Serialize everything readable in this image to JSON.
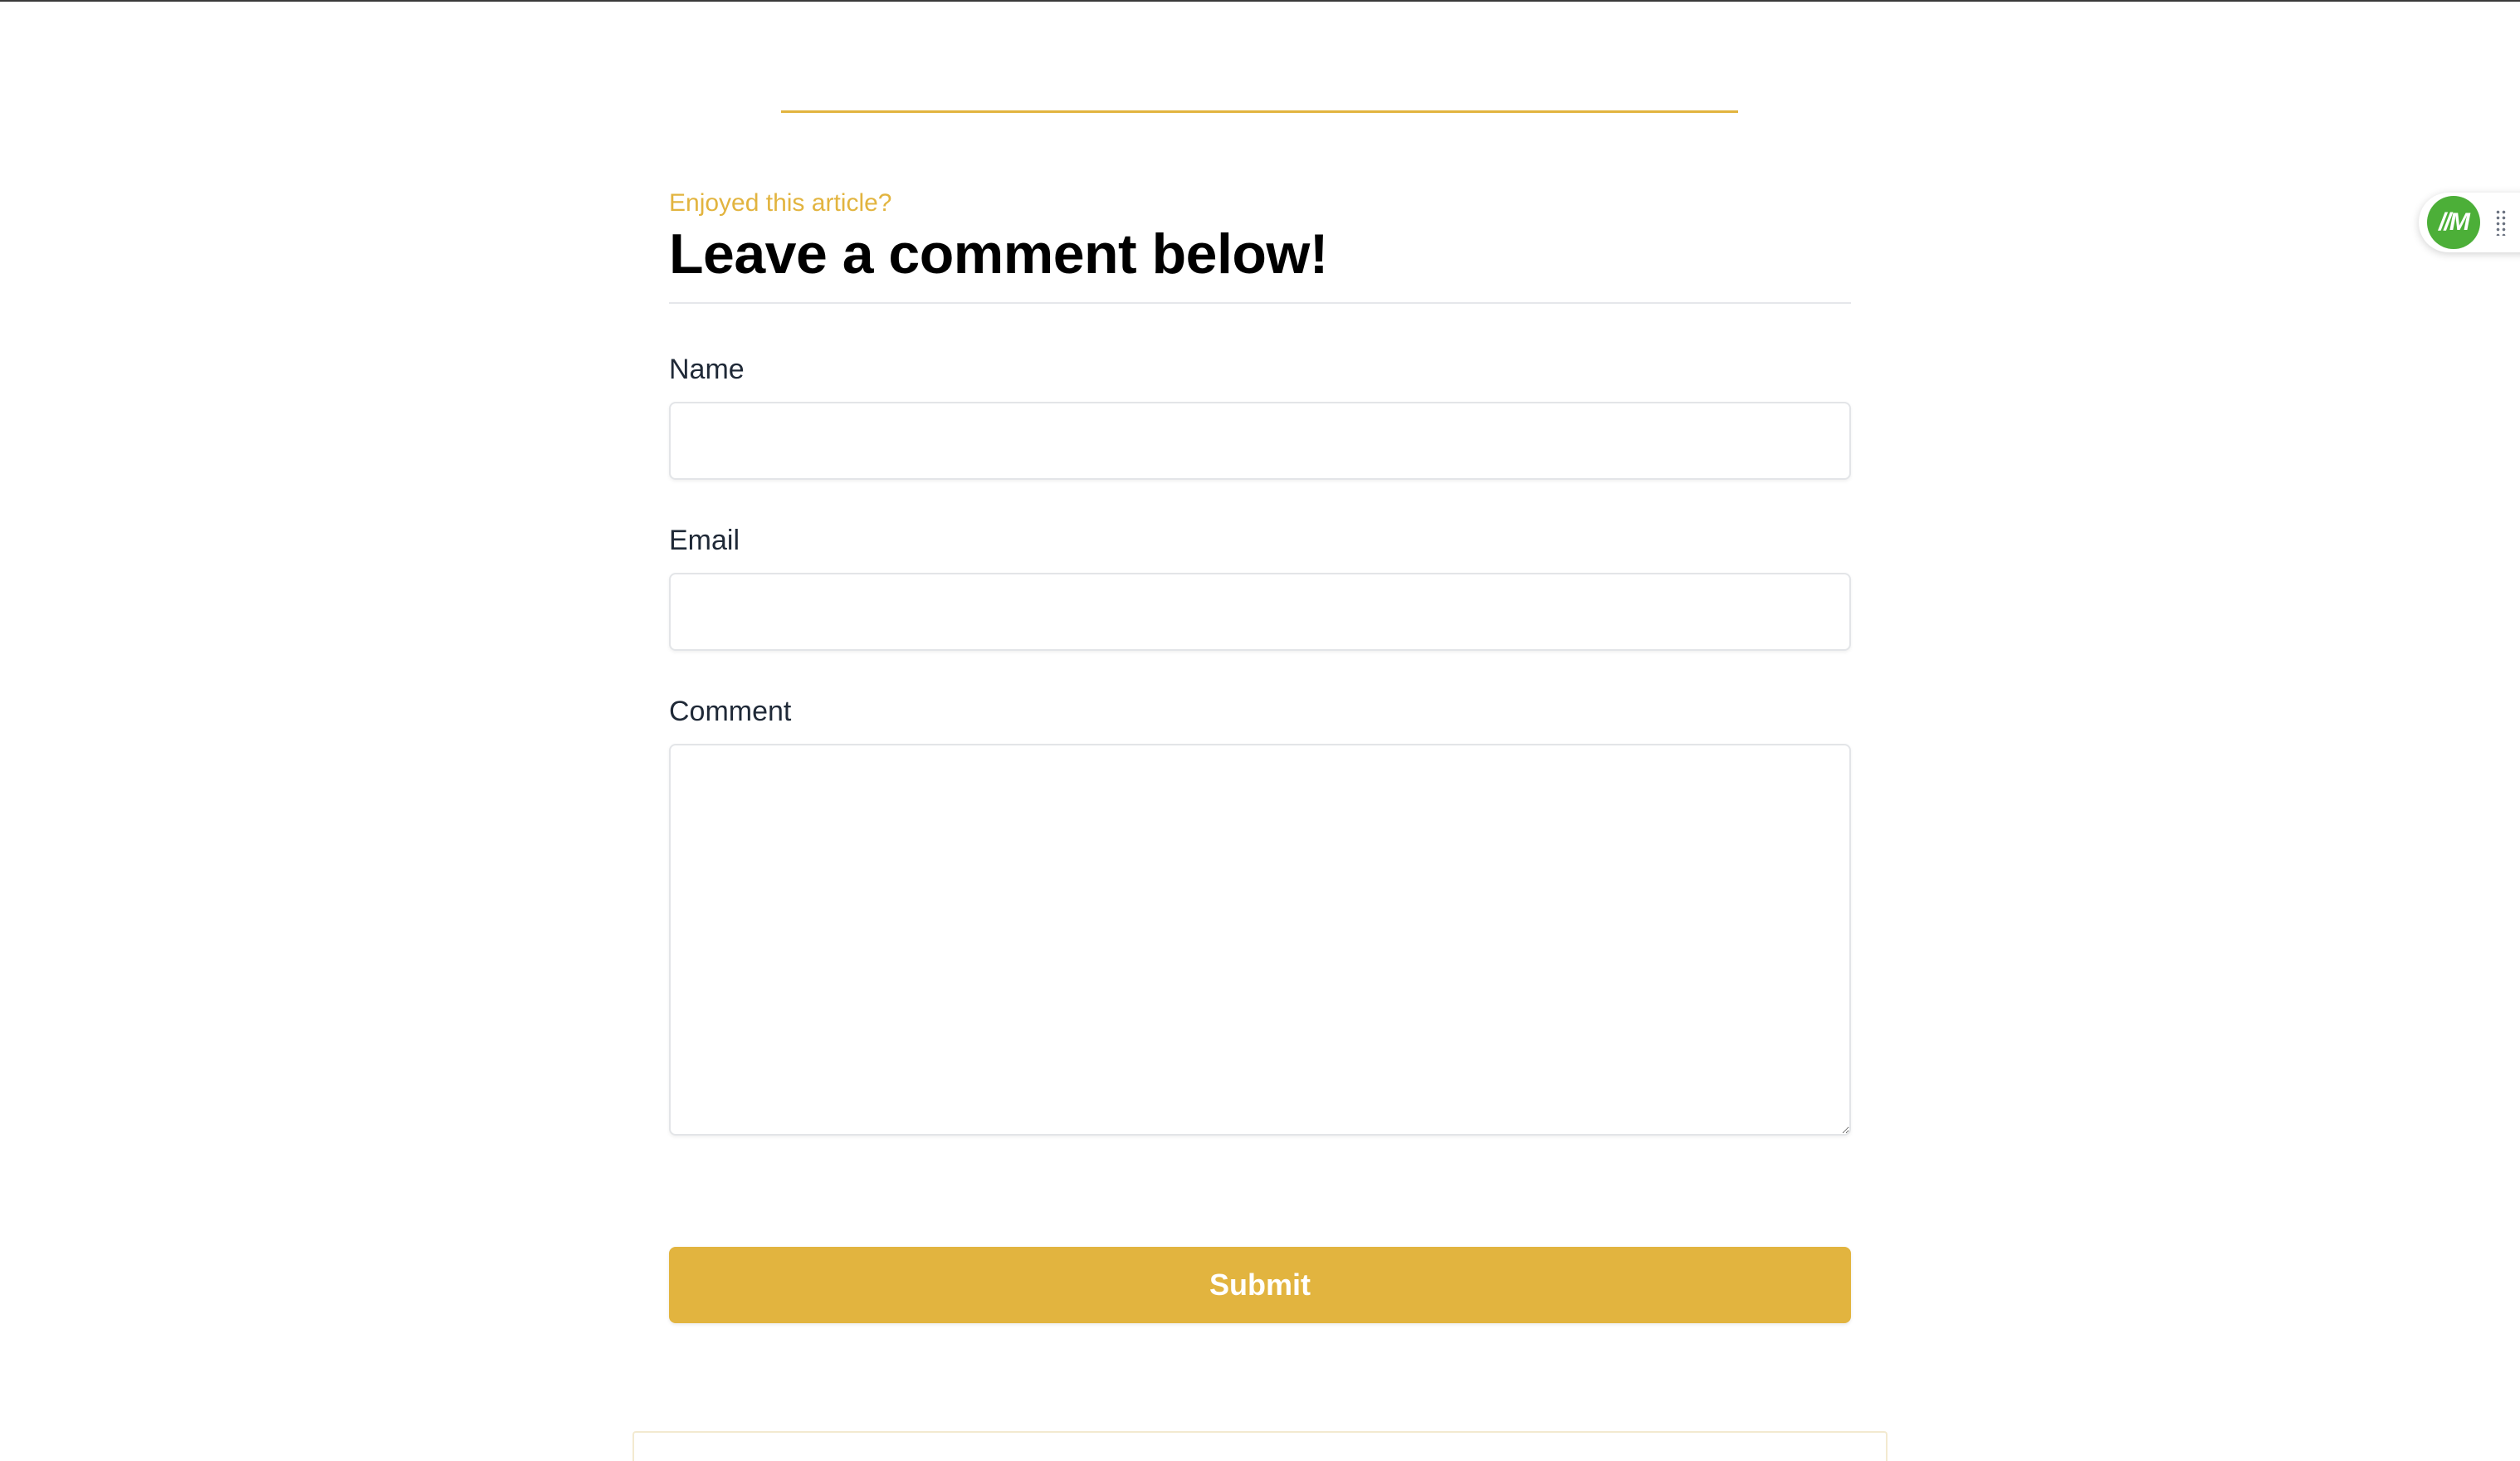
{
  "comment_form": {
    "eyebrow": "Enjoyed this article?",
    "heading": "Leave a comment below!",
    "fields": {
      "name": {
        "label": "Name",
        "value": "",
        "placeholder": ""
      },
      "email": {
        "label": "Email",
        "value": "",
        "placeholder": ""
      },
      "comment": {
        "label": "Comment",
        "value": "",
        "placeholder": ""
      }
    },
    "submit_label": "Submit"
  },
  "widget": {
    "logo_text": "//M",
    "logo_icon": "brand-logo-icon",
    "handle_icon": "drag-handle-icon"
  },
  "colors": {
    "accent": "#e2b43f",
    "widget_green": "#4caf38",
    "heading_text": "#000000",
    "body_text": "#1f2937"
  }
}
